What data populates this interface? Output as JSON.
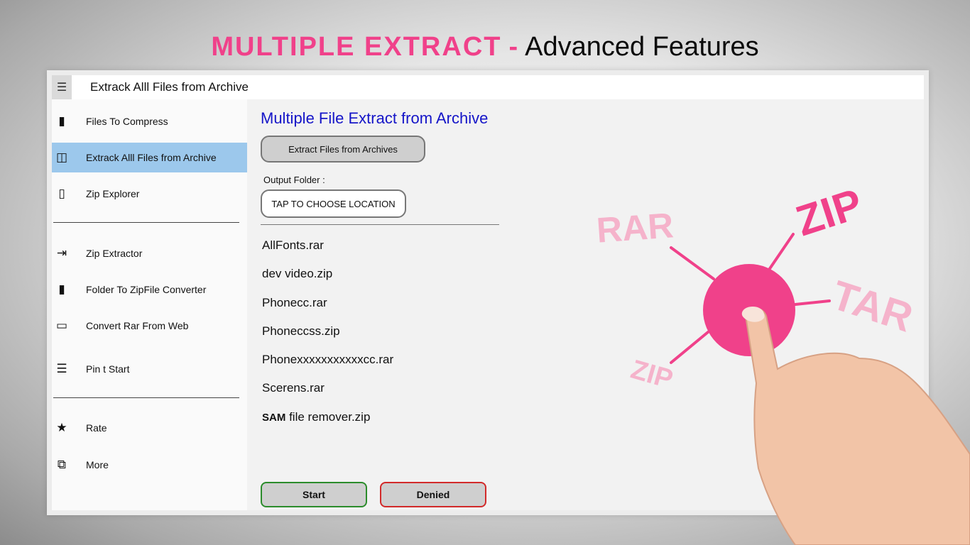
{
  "headline": {
    "accent": "MULTIPLE EXTRACT",
    "separator": "-",
    "rest": "Advanced Features"
  },
  "titlebar": {
    "menu_icon": "hamburger-icon",
    "title": "Extrack Alll Files from  Archive"
  },
  "sidebar": {
    "items": [
      {
        "label": "Files To Compress",
        "icon": "file-icon",
        "glyph": "▮"
      },
      {
        "label": "Extrack Alll Files from  Archive",
        "icon": "archive-icon",
        "glyph": "◫",
        "selected": true
      },
      {
        "label": "Zip Explorer",
        "icon": "folder-icon",
        "glyph": "▯"
      },
      {
        "label": "Zip Extractor",
        "icon": "extract-icon",
        "glyph": "⇥"
      },
      {
        "label": "Folder To ZipFile Converter",
        "icon": "folder-zip-icon",
        "glyph": "▮"
      },
      {
        "label": "Convert Rar From Web",
        "icon": "web-icon",
        "glyph": "▭"
      },
      {
        "label": "Pin t Start",
        "icon": "pin-icon",
        "glyph": "☰"
      },
      {
        "label": "Rate",
        "icon": "star-icon",
        "glyph": "★"
      },
      {
        "label": "More",
        "icon": "more-icon",
        "glyph": "⧉"
      }
    ]
  },
  "main": {
    "section_title": "Multiple File Extract from Archive",
    "extract_button": "Extract Files from Archives",
    "output_label": "Output Folder :",
    "location_button": "TAP TO CHOOSE LOCATION",
    "files": [
      "AllFonts.rar",
      "dev video.zip",
      "Phonecc.rar",
      "Phoneccss.zip",
      "Phonexxxxxxxxxxxcc.rar",
      "Scerens.rar"
    ],
    "last_file_prefix": "SAM",
    "last_file_rest": "file remover.zip",
    "start_button": "Start",
    "denied_button": "Denied"
  },
  "graphic": {
    "labels": {
      "rar": "RAR",
      "zip_top": "ZIP",
      "tar": "TAR",
      "zip_bottom": "ZIP"
    },
    "colors": {
      "hub": "#f0418a",
      "light_text": "#f5b3cb",
      "strong_text": "#f0418a"
    }
  }
}
